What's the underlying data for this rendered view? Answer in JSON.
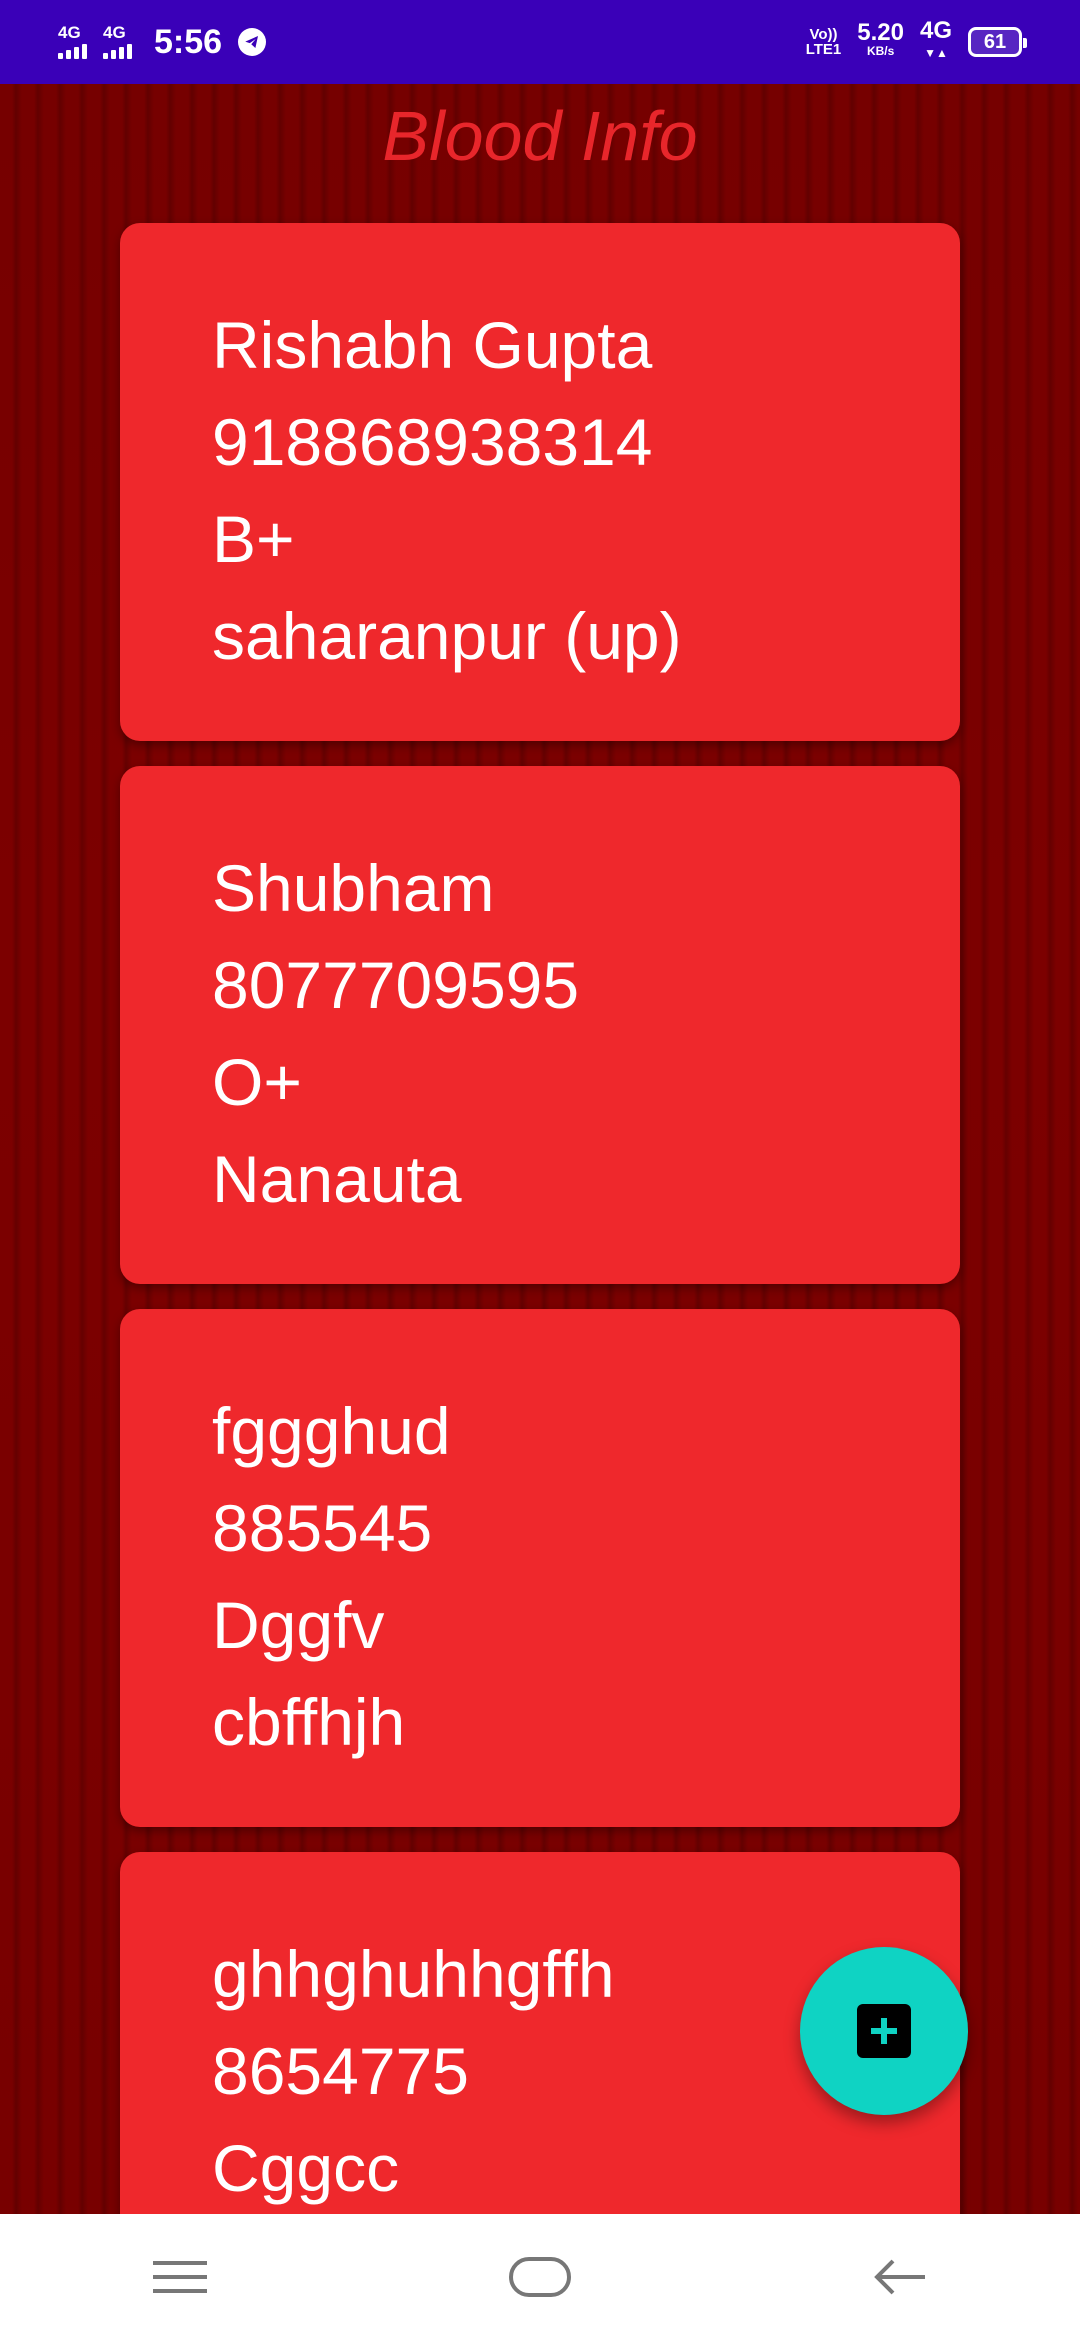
{
  "status_bar": {
    "signal1": "4G",
    "signal2": "4G",
    "time": "5:56",
    "volte_top": "Vo))",
    "volte_bottom": "LTE1",
    "speed_value": "5.20",
    "speed_unit": "KB/s",
    "network": "4G",
    "battery": "61"
  },
  "header": {
    "title": "Blood Info"
  },
  "donors": [
    {
      "name": "Rishabh Gupta",
      "phone": "918868938314",
      "blood_group": "B+",
      "location": "saharanpur (up)"
    },
    {
      "name": "Shubham",
      "phone": "8077709595",
      "blood_group": "O+",
      "location": "Nanauta"
    },
    {
      "name": "fggghud",
      "phone": "885545",
      "blood_group": "Dggfv",
      "location": "cbffhjh"
    },
    {
      "name": "ghhghuhhgffh",
      "phone": "8654775",
      "blood_group": "Cggcc",
      "location": ""
    }
  ],
  "icons": {
    "fab": "add-icon",
    "nav_menu": "menu-icon",
    "nav_home": "home-icon",
    "nav_back": "back-icon"
  },
  "colors": {
    "status_bar": "#3a00b8",
    "background": "#7a0000",
    "card": "#ef282c",
    "title": "#e8262b",
    "fab": "#0fd3c3"
  }
}
